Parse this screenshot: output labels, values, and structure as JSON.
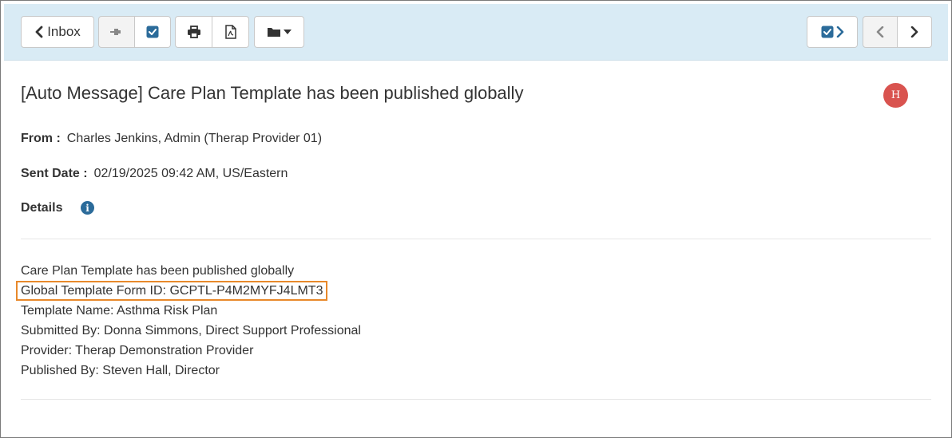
{
  "toolbar": {
    "inbox_label": "Inbox",
    "icons": [
      "chevron-left-icon",
      "pin-icon",
      "checkbox-checked-icon",
      "print-icon",
      "pdf-icon",
      "folder-icon",
      "caret-down-icon",
      "chevron-right-icon",
      "chevron-left-icon",
      "chevron-right-icon"
    ]
  },
  "message": {
    "subject": "[Auto Message] Care Plan Template has been published globally",
    "avatar_initial": "H",
    "from_label": "From :",
    "from_value": "Charles Jenkins, Admin (Therap Provider 01)",
    "sent_label": "Sent Date :",
    "sent_value": "02/19/2025 09:42 AM, US/Eastern",
    "details_label": "Details",
    "body": [
      "Care Plan Template has been published globally",
      "Global Template Form ID: GCPTL-P4M2MYFJ4LMT3",
      "Template Name: Asthma Risk Plan",
      "Submitted By: Donna Simmons, Direct Support Professional",
      "Provider: Therap Demonstration Provider",
      "Published By: Steven Hall, Director"
    ]
  },
  "colors": {
    "toolbar_bg": "#d9ebf5",
    "accent_blue": "#2b6b9a",
    "avatar_bg": "#d9534f",
    "highlight_border": "#e8892b"
  }
}
